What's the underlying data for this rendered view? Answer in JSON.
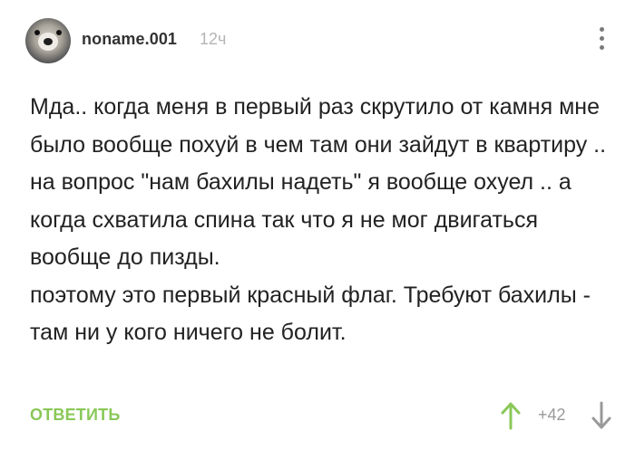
{
  "comment": {
    "author": "noname.001",
    "time": "12ч",
    "paragraphs": [
      "Мда.. когда меня в первый раз скрутило от камня мне было вообще похуй в чем там они зайдут в квартиру .. на вопрос \"нам бахилы надеть\" я вообще охуел .. а когда схватила спина так что я не мог двигаться вообще до пизды.",
      "поэтому это первый красный флаг. Требуют бахилы - там ни у кого ничего не болит."
    ],
    "reply_label": "ОТВЕТИТЬ",
    "rating": "+42"
  },
  "icons": {
    "more": "vertical-dots-icon",
    "upvote": "arrow-up-icon",
    "downvote": "arrow-down-icon"
  },
  "colors": {
    "accent_green": "#8ac858",
    "muted_gray": "#9a9a9a",
    "text": "#222222"
  }
}
